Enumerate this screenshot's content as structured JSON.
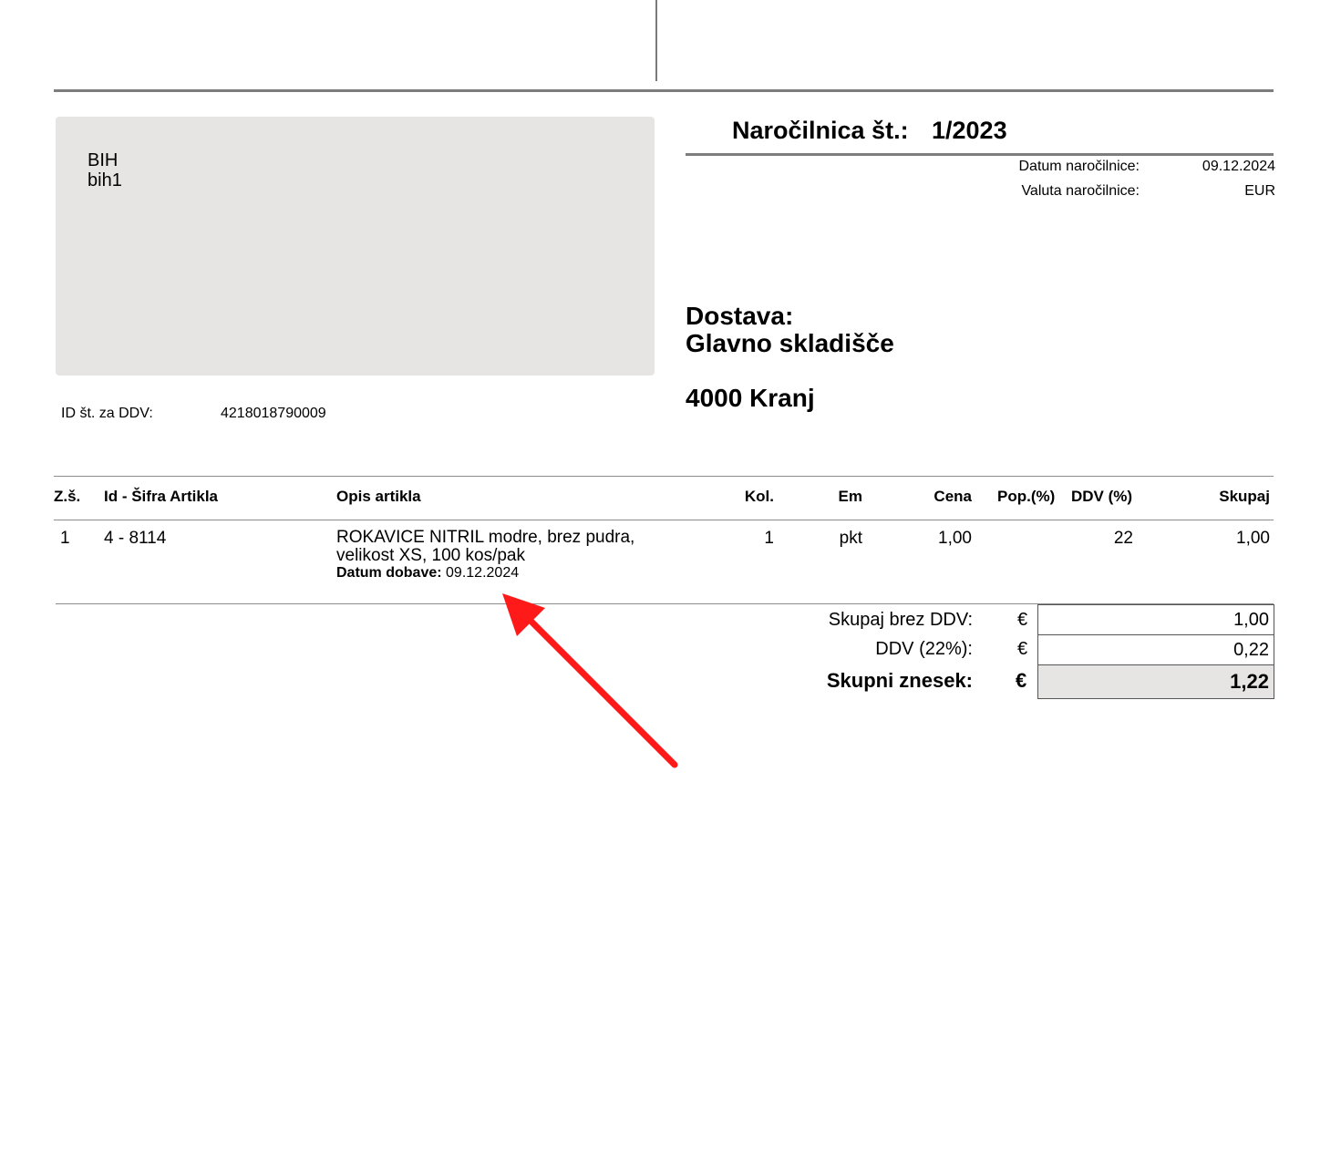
{
  "recipient": {
    "lines": [
      "BIH",
      "bih1"
    ],
    "vat_label": "ID št. za DDV:",
    "vat_value": "4218018790009"
  },
  "document": {
    "title": "Naročilnica št.:",
    "number": "1/2023",
    "meta": [
      {
        "label": "Datum naročilnice:",
        "value": "09.12.2024"
      },
      {
        "label": "Valuta naročilnice:",
        "value": "EUR"
      }
    ]
  },
  "delivery": {
    "heading": "Dostava:",
    "name": "Glavno skladišče",
    "city": "4000 Kranj"
  },
  "table": {
    "headers": {
      "no": "Z.š.",
      "code": "Id - Šifra Artikla",
      "desc": "Opis artikla",
      "qty": "Kol.",
      "unit": "Em",
      "price": "Cena",
      "discount": "Pop.(%)",
      "vat": "DDV (%)",
      "total": "Skupaj"
    },
    "rows": [
      {
        "no": "1",
        "code": "4 - 8114",
        "desc_line1": "ROKAVICE NITRIL modre, brez pudra,",
        "desc_line2": "velikost XS, 100 kos/pak",
        "delivery_label": "Datum dobave:",
        "delivery_date": "09.12.2024",
        "qty": "1",
        "unit": "pkt",
        "price": "1,00",
        "discount": "",
        "vat": "22",
        "total": "1,00"
      }
    ]
  },
  "summary": {
    "currency_symbol": "€",
    "net_label": "Skupaj brez DDV:",
    "net_value": "1,00",
    "vat_label": "DDV (22%):",
    "vat_value": "0,22",
    "total_label": "Skupni znesek:",
    "total_value": "1,22"
  },
  "colors": {
    "annotation_arrow": "#ff1a1a",
    "address_box": "#e6e5e4",
    "total_box": "#e6e5e4"
  }
}
